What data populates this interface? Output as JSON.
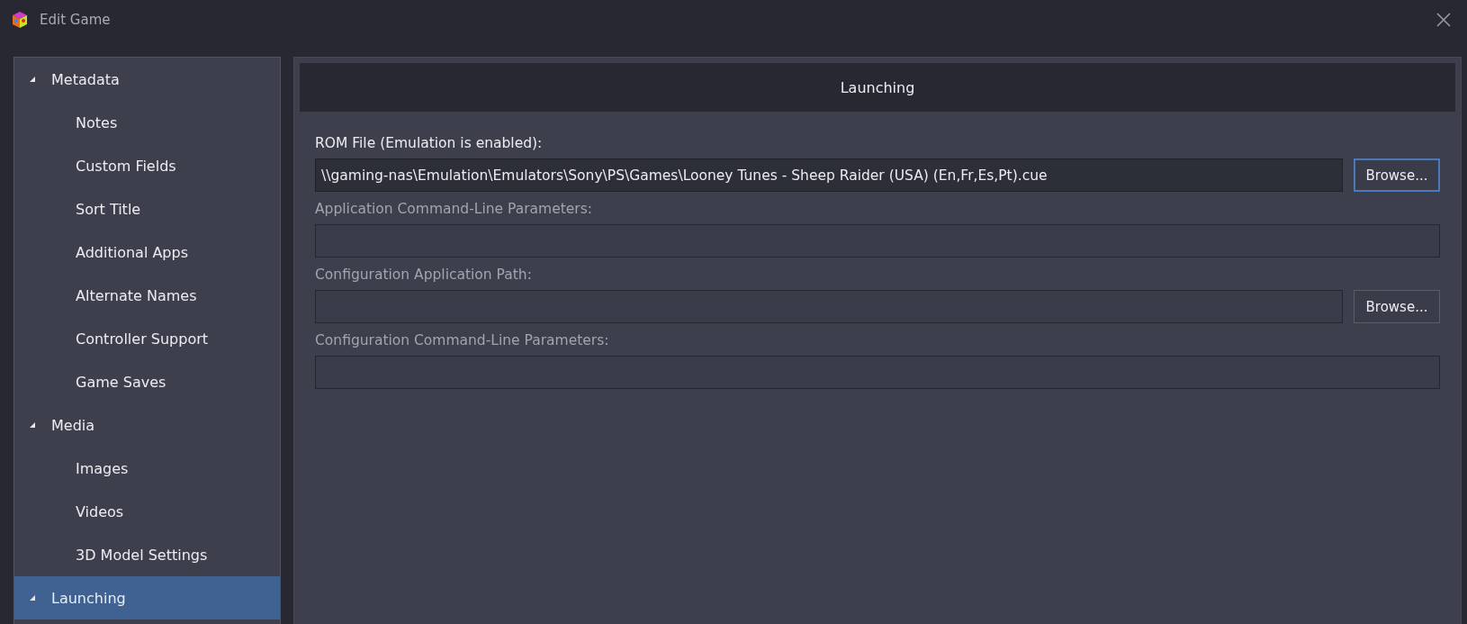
{
  "window": {
    "title": "Edit Game"
  },
  "sidebar": {
    "items": [
      {
        "label": "Metadata",
        "expanded": true,
        "selected": false,
        "children": [
          {
            "label": "Notes",
            "selected": false
          },
          {
            "label": "Custom Fields",
            "selected": false
          },
          {
            "label": "Sort Title",
            "selected": false
          },
          {
            "label": "Additional Apps",
            "selected": false
          },
          {
            "label": "Alternate Names",
            "selected": false
          },
          {
            "label": "Controller Support",
            "selected": false
          },
          {
            "label": "Game Saves",
            "selected": false
          }
        ]
      },
      {
        "label": "Media",
        "expanded": true,
        "selected": false,
        "children": [
          {
            "label": "Images",
            "selected": false
          },
          {
            "label": "Videos",
            "selected": false
          },
          {
            "label": "3D Model Settings",
            "selected": false
          }
        ]
      },
      {
        "label": "Launching",
        "expanded": true,
        "selected": true
      }
    ]
  },
  "panel": {
    "title": "Launching",
    "fields": [
      {
        "label": "ROM File (Emulation is enabled):",
        "value": "\\\\gaming-nas\\Emulation\\Emulators\\Sony\\PS\\Games\\Looney Tunes - Sheep Raider (USA) (En,Fr,Es,Pt).cue",
        "disabled": false,
        "button": {
          "label": "Browse...",
          "focused": true
        }
      },
      {
        "label": "Application Command-Line Parameters:",
        "disabled": true
      },
      {
        "label": "Configuration Application Path:",
        "disabled": true,
        "button": {
          "label": "Browse...",
          "focused": false
        }
      },
      {
        "label": "Configuration Command-Line Parameters:",
        "disabled": true
      }
    ]
  }
}
